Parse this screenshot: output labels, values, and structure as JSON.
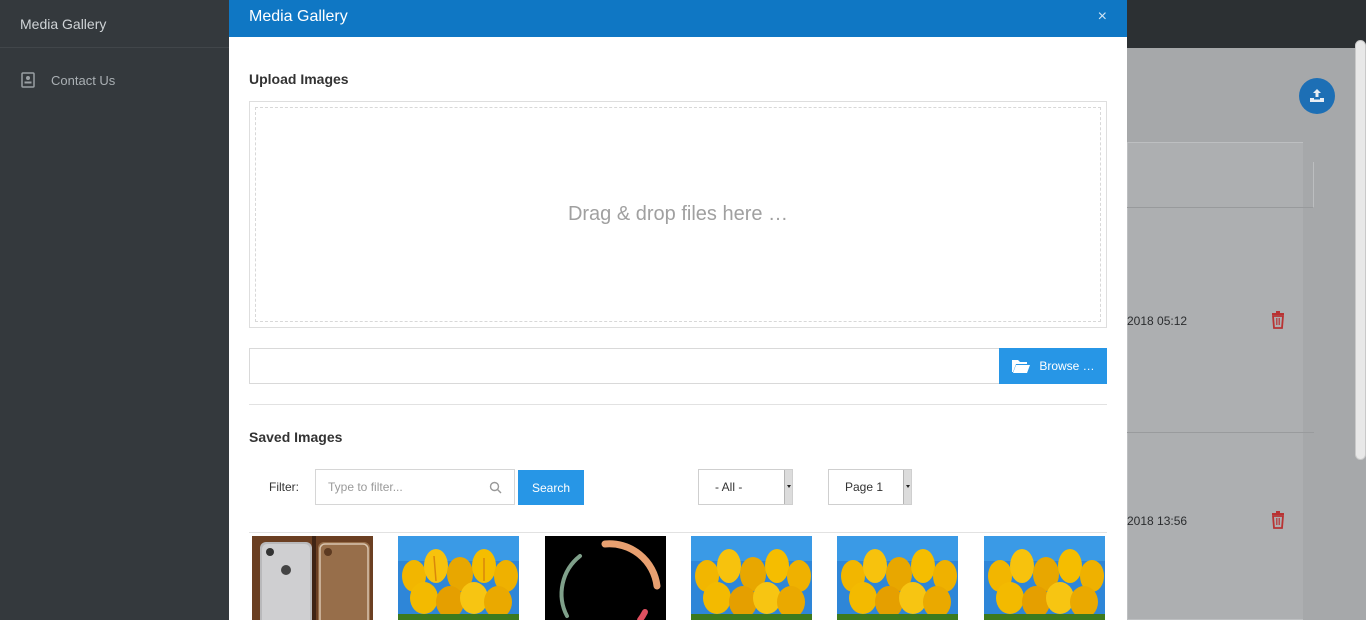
{
  "sidebar": {
    "title": "Media Gallery",
    "items": [
      {
        "label": "Contact Us",
        "icon": "contact-card-icon"
      }
    ]
  },
  "background": {
    "rows": [
      {
        "date": "2018 05:12"
      },
      {
        "date": "2018 13:56"
      }
    ]
  },
  "modal": {
    "title": "Media Gallery",
    "close": "×",
    "upload_title": "Upload Images",
    "dropzone_text": "Drag & drop files here …",
    "browse_label": "Browse …",
    "saved_title": "Saved Images",
    "filter": {
      "label": "Filter:",
      "placeholder": "Type to filter...",
      "search_label": "Search"
    },
    "category_select": {
      "value": "- All -"
    },
    "page_select": {
      "value": "Page 1"
    },
    "thumbnails": [
      {
        "alt": "iphone-with-case"
      },
      {
        "alt": "yellow-tulips"
      },
      {
        "alt": "circular-logo"
      },
      {
        "alt": "yellow-tulips"
      },
      {
        "alt": "yellow-tulips"
      },
      {
        "alt": "yellow-tulips"
      }
    ]
  },
  "colors": {
    "header": "#0f77c4",
    "primary_button": "#2796e6",
    "danger_icon": "#b83232"
  }
}
